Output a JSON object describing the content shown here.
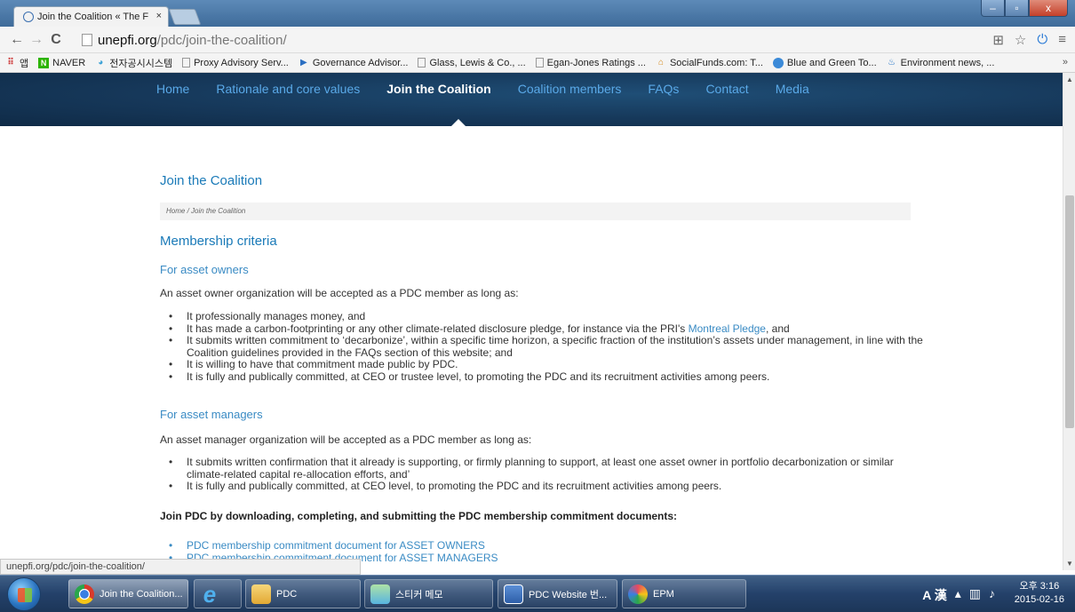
{
  "browser": {
    "tab_title": "Join the Coalition « The F",
    "tab_close": "×",
    "url_host": "unepfi.org",
    "url_path": "/pdc/join-the-coalition/",
    "nav_back": "←",
    "nav_forward": "→",
    "nav_reload": "C",
    "window_minimize": "–",
    "window_maximize": "▫",
    "window_close": "x",
    "bookmarks": [
      {
        "label": "앱",
        "icon": "apps-icon"
      },
      {
        "label": "NAVER",
        "icon": "naver-icon"
      },
      {
        "label": "전자공시시스템",
        "icon": "dart-icon"
      },
      {
        "label": "Proxy Advisory Serv...",
        "icon": "page-icon"
      },
      {
        "label": "Governance Advisor...",
        "icon": "play-icon"
      },
      {
        "label": "Glass, Lewis & Co., ...",
        "icon": "page-icon"
      },
      {
        "label": "Egan-Jones Ratings ...",
        "icon": "page-icon"
      },
      {
        "label": "SocialFunds.com: T...",
        "icon": "house-icon"
      },
      {
        "label": "Blue and Green To...",
        "icon": "globe-icon"
      },
      {
        "label": "Environment news, ...",
        "icon": "env-icon"
      }
    ],
    "bookmarks_more": "»",
    "status_url": "unepfi.org/pdc/join-the-coalition/"
  },
  "site": {
    "nav": [
      {
        "label": "Home",
        "active": false
      },
      {
        "label": "Rationale and core values",
        "active": false
      },
      {
        "label": "Join the Coalition",
        "active": true
      },
      {
        "label": "Coalition members",
        "active": false
      },
      {
        "label": "FAQs",
        "active": false
      },
      {
        "label": "Contact",
        "active": false
      },
      {
        "label": "Media",
        "active": false
      }
    ]
  },
  "page": {
    "title": "Join the Coalition",
    "breadcrumb": "Home  /  Join the Coalition",
    "criteria_heading": "Membership criteria",
    "owners_heading": "For asset owners",
    "owners_intro": "An asset owner organization will be accepted as a PDC member as long as:",
    "owners_items": [
      {
        "text": "It professionally manages money, and"
      },
      {
        "before": "It has made a carbon-footprinting or any other climate-related disclosure pledge, for instance via the PRI's ",
        "link": "Montreal Pledge",
        "after": ", and"
      },
      {
        "text": "It submits written commitment to ‘decarbonize’, within a specific time horizon, a specific fraction of the institution’s assets under management, in line with the Coalition guidelines provided in the FAQs section of this website; and"
      },
      {
        "text": "It is willing to have that commitment made public by PDC."
      },
      {
        "text": "It is fully and publically committed, at CEO or trustee level, to promoting the PDC and its recruitment activities among peers."
      }
    ],
    "managers_heading": "For asset managers",
    "managers_intro": "An asset manager organization will be accepted as a PDC member as long as:",
    "managers_items": [
      {
        "text": "It submits written confirmation that it already is supporting, or firmly planning to support, at least one asset owner in portfolio decarbonization or similar climate-related capital re-allocation efforts, and’"
      },
      {
        "text": "It is fully and publically committed, at CEO level, to promoting the PDC and its recruitment activities among peers."
      }
    ],
    "join_heading": "Join PDC by downloading, completing, and submitting the PDC membership commitment documents:",
    "doc_links": [
      {
        "text": "PDC membership commitment document for ASSET OWNERS"
      },
      {
        "text": "PDC membership commitment document for ASSET MANAGERS"
      }
    ]
  },
  "taskbar": {
    "items": [
      {
        "label": "Join the Coalition...",
        "icon": "chrome-icon",
        "active": true
      },
      {
        "label": "",
        "icon": "ie-icon",
        "active": false
      },
      {
        "label": "PDC",
        "icon": "folder-icon",
        "active": false
      },
      {
        "label": "스티커 메모",
        "icon": "sticky-notes-icon",
        "active": false
      },
      {
        "label": "PDC Website 번...",
        "icon": "word-icon",
        "active": false
      },
      {
        "label": "EPM",
        "icon": "epm-icon",
        "active": false
      }
    ],
    "ime": "A 漢",
    "clock_time": "오후 3:16",
    "clock_date": "2015-02-16"
  }
}
